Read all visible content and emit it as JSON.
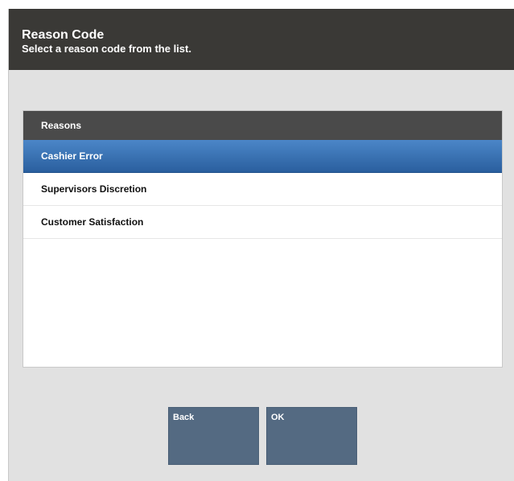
{
  "header": {
    "title": "Reason Code",
    "subtitle": "Select a reason code from the list."
  },
  "list": {
    "header": "Reasons",
    "items": [
      {
        "label": "Cashier Error",
        "selected": true
      },
      {
        "label": "Supervisors Discretion",
        "selected": false
      },
      {
        "label": "Customer Satisfaction",
        "selected": false
      }
    ]
  },
  "buttons": {
    "back": "Back",
    "ok": "OK"
  },
  "colors": {
    "header_bg": "#3a3936",
    "selected_bg": "#3b76b6",
    "button_bg": "#546a82",
    "page_bg": "#e1e1e1"
  }
}
